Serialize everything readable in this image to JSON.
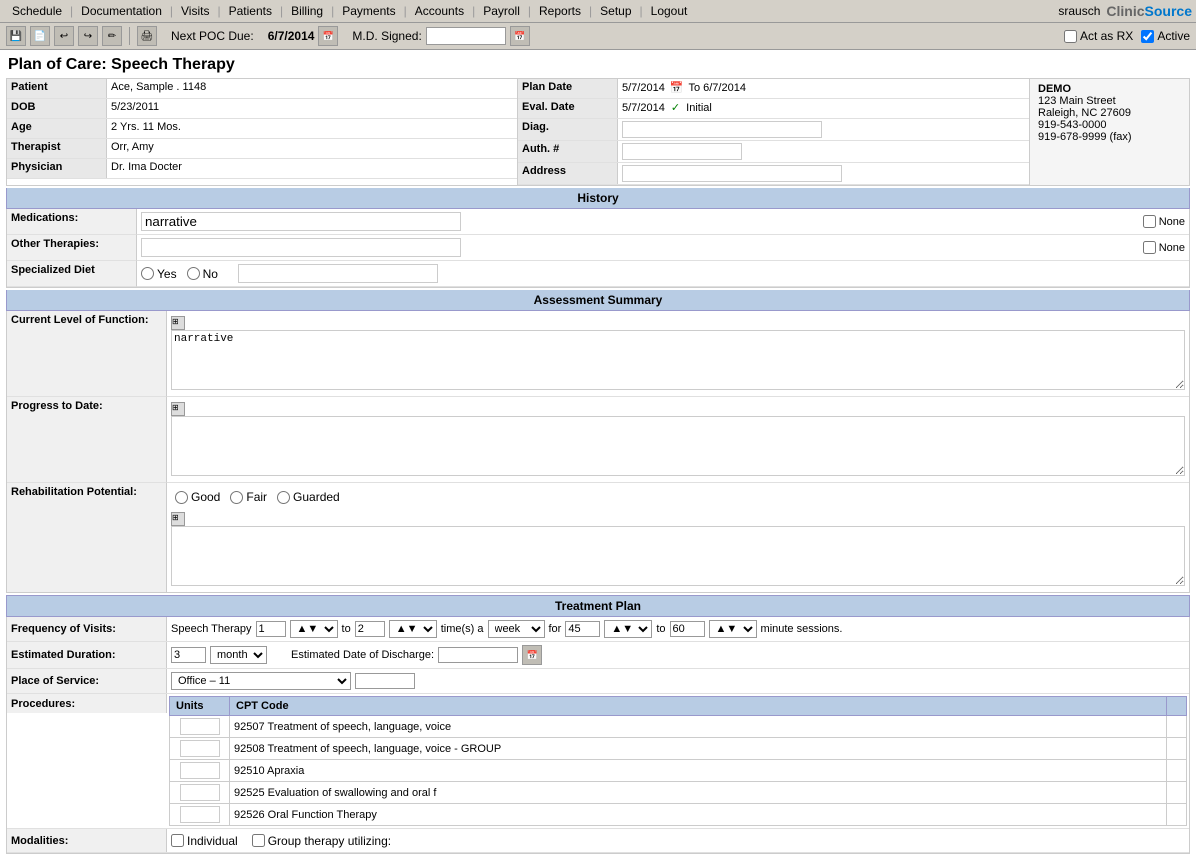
{
  "nav": {
    "items": [
      "Schedule",
      "Documentation",
      "Visits",
      "Patients",
      "Billing",
      "Payments",
      "Accounts",
      "Payroll",
      "Reports",
      "Setup",
      "Logout"
    ],
    "user": "srausch",
    "brand": "Clinic",
    "brandHighlight": "Source"
  },
  "toolbar": {
    "next_poc_label": "Next POC Due:",
    "next_poc_date": "6/7/2014",
    "md_signed_label": "M.D. Signed:",
    "act_as_rx_label": "Act as RX",
    "active_label": "Active"
  },
  "page": {
    "title": "Plan of Care: Speech Therapy"
  },
  "patient_info": {
    "patient_label": "Patient",
    "patient_value": "Ace, Sample .  1148",
    "dob_label": "DOB",
    "dob_value": "5/23/2011",
    "age_label": "Age",
    "age_value": "2 Yrs. 11 Mos.",
    "therapist_label": "Therapist",
    "therapist_value": "Orr, Amy",
    "physician_label": "Physician",
    "physician_value": "Dr. Ima Docter",
    "plan_date_label": "Plan Date",
    "plan_date_value": "5/7/2014",
    "plan_date_to": "To 6/7/2014",
    "eval_date_label": "Eval. Date",
    "eval_date_value": "5/7/2014",
    "eval_type": "Initial",
    "diag_label": "Diag.",
    "auth_label": "Auth. #",
    "address_label": "Address",
    "clinic_name": "DEMO",
    "clinic_address": "123 Main Street",
    "clinic_city": "Raleigh, NC 27609",
    "clinic_phone": "919-543-0000",
    "clinic_fax": "919-678-9999 (fax)"
  },
  "history": {
    "section_label": "History",
    "medications_label": "Medications:",
    "medications_value": "narrative",
    "medications_none": "None",
    "other_therapies_label": "Other Therapies:",
    "other_therapies_none": "None",
    "specialized_diet_label": "Specialized Diet",
    "diet_yes": "Yes",
    "diet_no": "No"
  },
  "assessment": {
    "section_label": "Assessment Summary",
    "current_level_label": "Current Level of Function:",
    "current_level_value": "narrative",
    "progress_label": "Progress to Date:",
    "rehab_label": "Rehabilitation Potential:",
    "rehab_good": "Good",
    "rehab_fair": "Fair",
    "rehab_guarded": "Guarded"
  },
  "treatment": {
    "section_label": "Treatment Plan",
    "frequency_label": "Frequency of Visits:",
    "therapy_type": "Speech Therapy",
    "freq_from": "1",
    "freq_to": "2",
    "times_label": "time(s) a",
    "freq_period": "week",
    "for_label": "for",
    "minutes_from": "45",
    "minutes_to": "60",
    "minutes_label": "minute sessions.",
    "duration_label": "Estimated Duration:",
    "duration_value": "3",
    "duration_unit": "month",
    "est_discharge_label": "Estimated Date of Discharge:",
    "place_label": "Place of Service:",
    "place_value": "Office – 11",
    "procedures_label": "Procedures:",
    "units_header": "Units",
    "cpt_header": "CPT Code",
    "procedures": [
      {
        "code": "92507 Treatment of speech, language, voice"
      },
      {
        "code": "92508 Treatment of speech, language, voice - GROUP"
      },
      {
        "code": "92510 Apraxia"
      },
      {
        "code": "92525 Evaluation of swallowing and oral f"
      },
      {
        "code": "92526 Oral Function Therapy"
      }
    ],
    "modalities_label": "Modalities:",
    "modalities_individual": "Individual",
    "modalities_group": "Group therapy utilizing:"
  }
}
